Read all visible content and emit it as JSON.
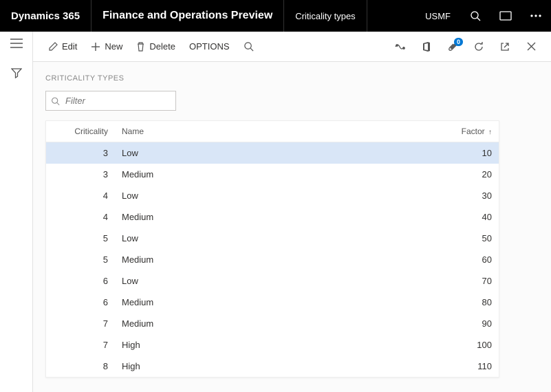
{
  "topbar": {
    "brand": "Dynamics 365",
    "title": "Finance and Operations Preview",
    "subtitle": "Criticality types",
    "company": "USMF"
  },
  "actions": {
    "edit": "Edit",
    "new": "New",
    "delete": "Delete",
    "options": "OPTIONS",
    "attachments_badge": "0"
  },
  "page": {
    "heading": "CRITICALITY TYPES",
    "filter_placeholder": "Filter"
  },
  "grid": {
    "columns": {
      "criticality": "Criticality",
      "name": "Name",
      "factor": "Factor"
    },
    "rows": [
      {
        "criticality": "3",
        "name": "Low",
        "factor": "10",
        "selected": true
      },
      {
        "criticality": "3",
        "name": "Medium",
        "factor": "20"
      },
      {
        "criticality": "4",
        "name": "Low",
        "factor": "30"
      },
      {
        "criticality": "4",
        "name": "Medium",
        "factor": "40"
      },
      {
        "criticality": "5",
        "name": "Low",
        "factor": "50"
      },
      {
        "criticality": "5",
        "name": "Medium",
        "factor": "60"
      },
      {
        "criticality": "6",
        "name": "Low",
        "factor": "70"
      },
      {
        "criticality": "6",
        "name": "Medium",
        "factor": "80"
      },
      {
        "criticality": "7",
        "name": "Medium",
        "factor": "90"
      },
      {
        "criticality": "7",
        "name": "High",
        "factor": "100"
      },
      {
        "criticality": "8",
        "name": "High",
        "factor": "110"
      }
    ]
  }
}
